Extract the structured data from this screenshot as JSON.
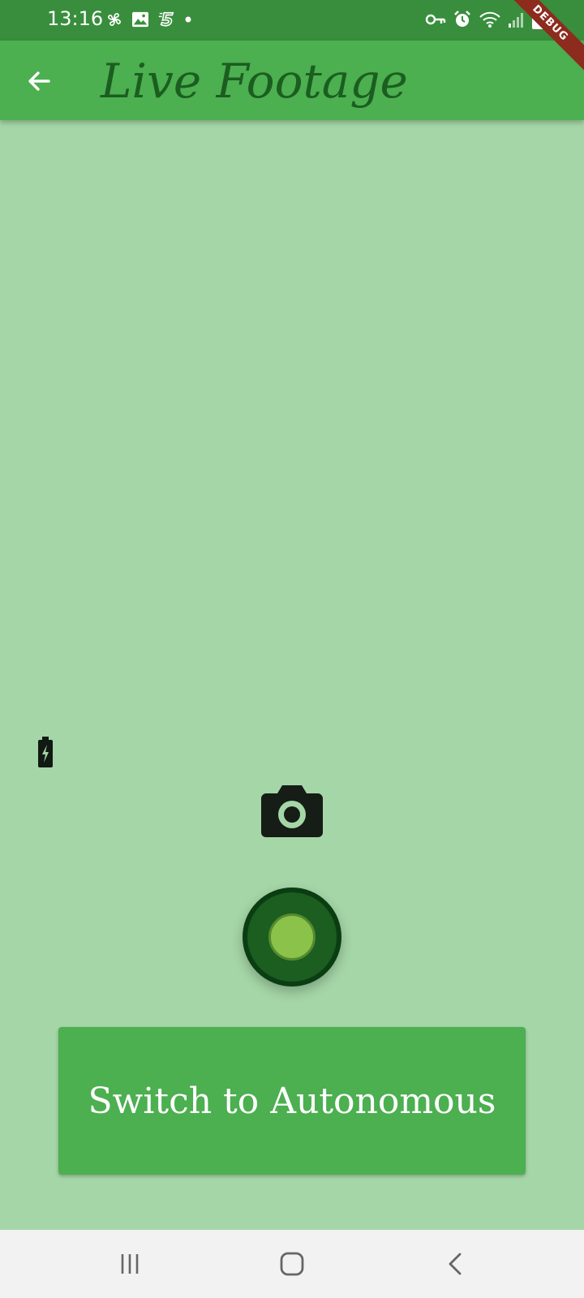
{
  "status_bar": {
    "time": "13:16",
    "left_icons": [
      "pinwheel-icon",
      "gallery-icon",
      "five-icon",
      "dot-icon"
    ],
    "right_icons": [
      "key-icon",
      "alarm-icon",
      "wifi-icon",
      "signal-icon",
      "battery-icon"
    ]
  },
  "app_bar": {
    "title": "Live Footage",
    "back_icon": "arrow-left-icon"
  },
  "debug_banner": "DEBUG",
  "controls": {
    "battery_icon": "battery-charging-icon",
    "camera_icon": "camera-icon",
    "record_icon": "record-icon",
    "switch_label": "Switch to Autonomous"
  },
  "nav_bar": {
    "items": [
      "recents-icon",
      "home-icon",
      "back-icon"
    ]
  },
  "colors": {
    "status_bar": "#388e3c",
    "app_bar": "#4caf50",
    "background": "#a5d6a7",
    "title_text": "#1b5e20",
    "record_outer": "#1b5e20",
    "record_inner": "#8bc34a",
    "button": "#4caf50"
  }
}
